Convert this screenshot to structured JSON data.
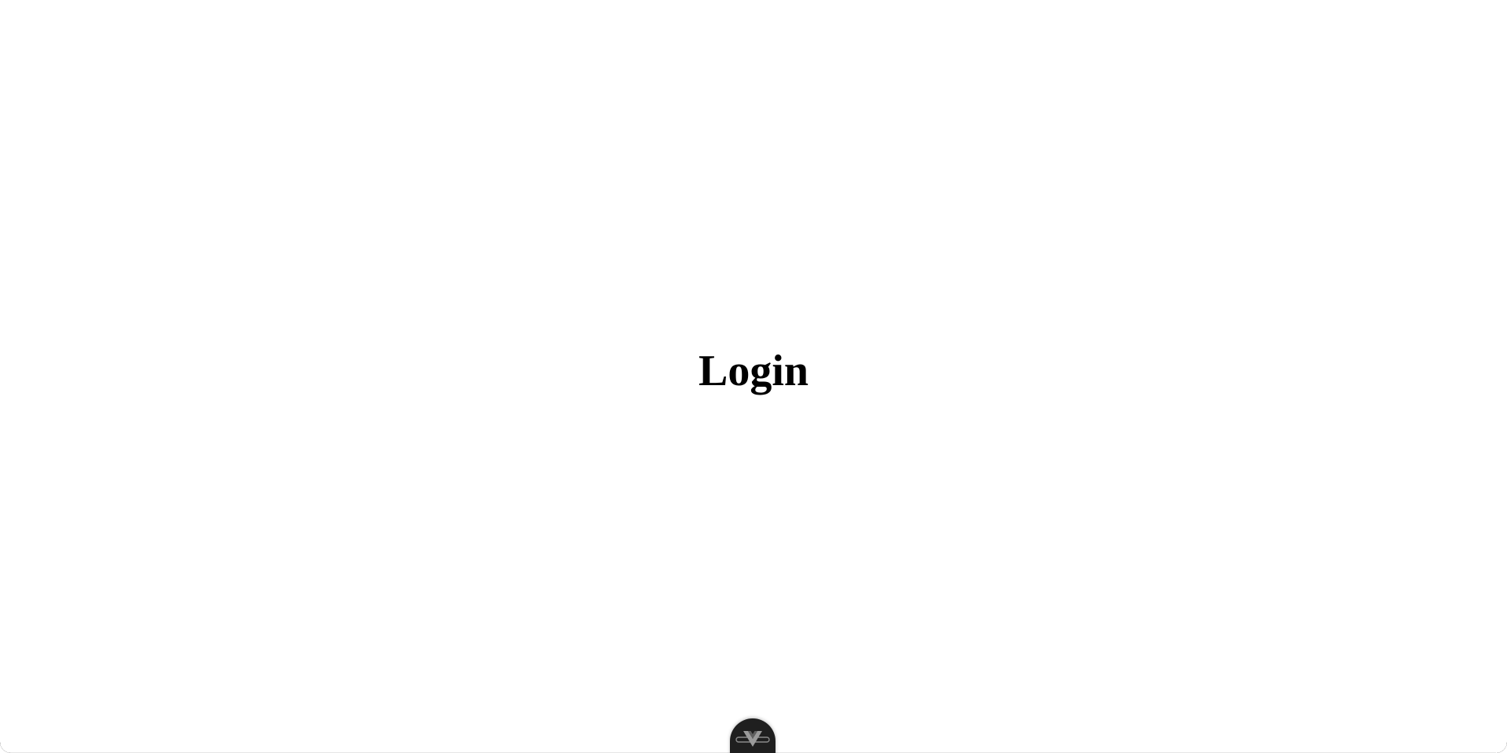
{
  "page": {
    "title": "Login"
  },
  "devtools": {
    "icon": "vue-logo-icon",
    "accent": "#8a8a8a",
    "background": "#1f1f1f"
  }
}
